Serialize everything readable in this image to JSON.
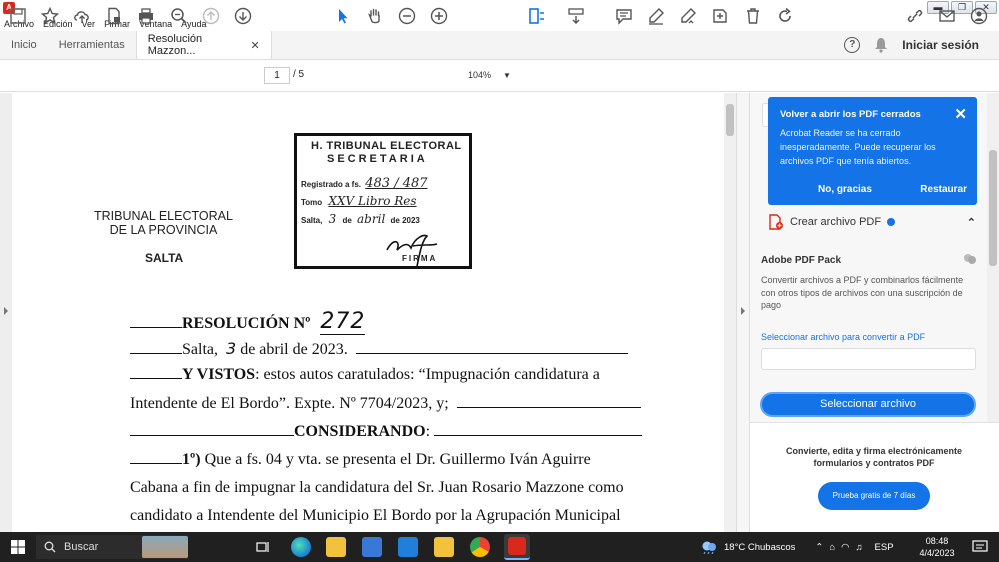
{
  "window": {
    "title_icon": "adobe-pdf-icon"
  },
  "menu": [
    "Archivo",
    "Edición",
    "Ver",
    "Firmar",
    "Ventana",
    "Ayuda"
  ],
  "tabs": {
    "home": "Inicio",
    "tools": "Herramientas",
    "doc": "Resolución Mazzon...",
    "close": "✕"
  },
  "header": {
    "help": "?",
    "signin": "Iniciar sesión"
  },
  "toolbar": {
    "page_current": "1",
    "page_total": "/ 5",
    "zoom": "104%"
  },
  "document": {
    "stamp": {
      "line1": "H. TRIBUNAL ELECTORAL",
      "line2": "SECRETARIA",
      "registrado_label": "Registrado a fs.",
      "registrado_value": "483 / 487",
      "tomo_label": "Tomo",
      "tomo_value": "XXV  Libro Res",
      "salta_label": "Salta,",
      "salta_day": "3",
      "salta_de": "de",
      "salta_month": "abril",
      "salta_year": "de 2023",
      "firma": "FIRMA"
    },
    "court": {
      "line1": "TRIBUNAL ELECTORAL",
      "line2": "DE LA PROVINCIA",
      "line3": "SALTA"
    },
    "resolution_label": "RESOLUCIÓN Nº",
    "resolution_number": "272",
    "line_date_pre": "Salta,",
    "line_date_day": "3",
    "line_date_post": "de abril de 2023.",
    "vistos_label": "Y VISTOS",
    "vistos_text": ": estos autos caratulados: “Impugnación candidatura a",
    "vistos_text2": "Intendente de El Bordo”. Expte. Nº 7704/2023, y;",
    "considerando": "CONSIDERANDO",
    "p1_num": "1º)",
    "p1_text": "Que a fs. 04 y vta. se presenta el Dr. Guillermo Iván Aguirre",
    "p1_line2": "Cabana a fin de impugnar la candidatura del Sr. Juan Rosario Mazzone como",
    "p1_line3": "candidato a Intendente del Municipio El Bordo por la Agrupación Municipal"
  },
  "notification": {
    "title": "Volver a abrir los PDF cerrados",
    "body": "Acrobat Reader se ha cerrado inesperadamente. Puede recuperar los archivos PDF que tenía abiertos.",
    "dismiss": "No, gracias",
    "restore": "Restaurar"
  },
  "right_panel": {
    "create_pdf": "Crear archivo PDF",
    "pack_title": "Adobe PDF Pack",
    "pack_desc": "Convertir archivos a PDF y combinarlos fácilmente con otros tipos de archivos con una suscripción de pago",
    "pack_link": "Seleccionar archivo para convertir a PDF",
    "select_button": "Seleccionar archivo",
    "promo": "Convierte, edita y firma electrónicamente formularios y contratos PDF",
    "trial_button": "Prueba gratis de 7 días"
  },
  "taskbar": {
    "search": "Buscar",
    "weather": "18°C  Chubascos",
    "lang": "ESP",
    "time": "08:48",
    "date": "4/4/2023"
  },
  "colors": {
    "accent": "#1473e6",
    "taskbar": "#202020",
    "adobe_red": "#d9291c"
  }
}
